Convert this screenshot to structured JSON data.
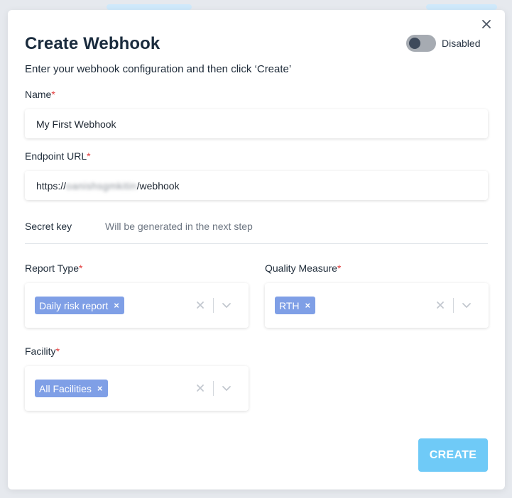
{
  "dialog": {
    "title": "Create Webhook",
    "subtitle": "Enter your webhook configuration and then click ‘Create’",
    "toggle": {
      "label": "Disabled",
      "enabled": false
    }
  },
  "form": {
    "name": {
      "label": "Name",
      "required_mark": "*",
      "value": "My First Webhook"
    },
    "endpoint": {
      "label": "Endpoint URL",
      "required_mark": "*",
      "value_prefix": "https://",
      "value_obscured": "oanishsgmkitin",
      "value_suffix": "/webhook"
    },
    "secret": {
      "label": "Secret key",
      "value": "Will be generated in the next step"
    },
    "report_type": {
      "label": "Report Type",
      "required_mark": "*",
      "selected": [
        "Daily risk report"
      ]
    },
    "quality_measure": {
      "label": "Quality Measure",
      "required_mark": "*",
      "selected": [
        "RTH"
      ]
    },
    "facility": {
      "label": "Facility",
      "required_mark": "*",
      "selected": [
        "All Facilities"
      ]
    }
  },
  "chip_remove_symbol": "×",
  "actions": {
    "create_label": "CREATE"
  },
  "colors": {
    "chip": "#7f9fe6",
    "primary_button": "#6fcaf7",
    "required": "#e23b3b",
    "toggle_track": "#a6abb2",
    "toggle_knob": "#3e4a5b"
  },
  "icons": {
    "close": "close-icon",
    "clear": "clear-icon",
    "dropdown": "chevron-down-icon"
  }
}
